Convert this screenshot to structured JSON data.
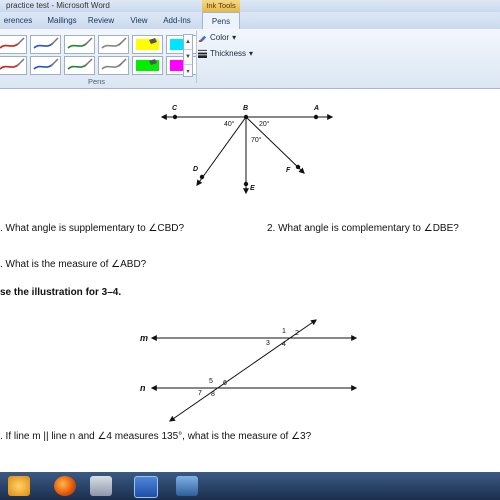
{
  "window": {
    "title": "practice test - Microsoft Word",
    "contextual_group": "Ink Tools"
  },
  "tabs": [
    {
      "label": "erences",
      "active": false
    },
    {
      "label": "Mailings",
      "active": false
    },
    {
      "label": "Review",
      "active": false
    },
    {
      "label": "View",
      "active": false
    },
    {
      "label": "Add-Ins",
      "active": false
    },
    {
      "label": "Pens",
      "active": true
    }
  ],
  "ribbon": {
    "group_label": "Pens",
    "options": {
      "color": "Color",
      "thickness": "Thickness"
    },
    "pens_row1": [
      "#cc2222",
      "#2a55c8",
      "#238833",
      "#888888",
      "#ffff00",
      "#00e5ff"
    ],
    "pens_row2": [
      "#cc2222",
      "#2a55c8",
      "#238833",
      "#888888",
      "#00ee00",
      "#ff00ff"
    ]
  },
  "figure1": {
    "points": {
      "C": "C",
      "B": "B",
      "A": "A",
      "D": "D",
      "E": "E",
      "F": "F"
    },
    "angles": {
      "left": "40°",
      "right": "20°",
      "middle": "70°"
    }
  },
  "questions": {
    "q1": ". What angle is supplementary to ∠CBD?",
    "q2": "2. What angle is complementary to ∠DBE?",
    "q3": ". What is the measure of ∠ABD?",
    "section": "se the illustration for 3–4.",
    "q4": ". If line m || line n and ∠4 measures 135°, what is the measure of ∠3?"
  },
  "figure2": {
    "line_m": "m",
    "line_n": "n",
    "angle_labels": [
      "1",
      "2",
      "3",
      "4",
      "5",
      "6",
      "7",
      "8"
    ]
  },
  "taskbar": {
    "apps": [
      "outlook-icon",
      "firefox-icon",
      "calculator-icon",
      "word-icon",
      "network-icon"
    ]
  }
}
